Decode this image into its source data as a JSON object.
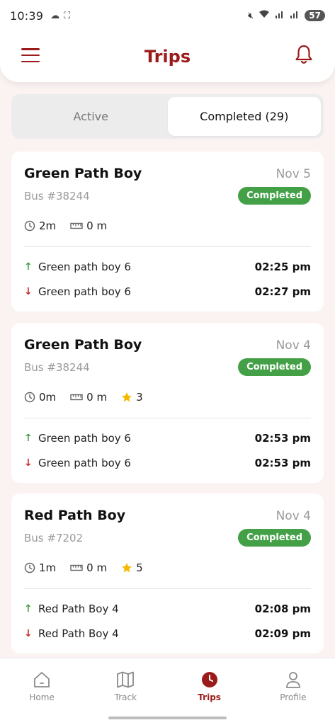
{
  "status_bar": {
    "time": "10:39",
    "battery": "57"
  },
  "header": {
    "title": "Trips",
    "accent_color": "#9b1b1b"
  },
  "tabs": [
    {
      "label": "Active",
      "active": false
    },
    {
      "label": "Completed (29)",
      "active": true
    }
  ],
  "trips": [
    {
      "name": "Green Path Boy",
      "date": "Nov 5",
      "bus": "Bus #38244",
      "status": "Completed",
      "duration": "2m",
      "distance": "0 m",
      "rating": null,
      "pickup": {
        "stop": "Green path boy 6",
        "time": "02:25 pm"
      },
      "drop": {
        "stop": "Green path boy 6",
        "time": "02:27 pm"
      }
    },
    {
      "name": "Green Path Boy",
      "date": "Nov 4",
      "bus": "Bus #38244",
      "status": "Completed",
      "duration": "0m",
      "distance": "0 m",
      "rating": "3",
      "pickup": {
        "stop": "Green path boy 6",
        "time": "02:53 pm"
      },
      "drop": {
        "stop": "Green path boy 6",
        "time": "02:53 pm"
      }
    },
    {
      "name": "Red Path Boy",
      "date": "Nov 4",
      "bus": "Bus #7202",
      "status": "Completed",
      "duration": "1m",
      "distance": "0 m",
      "rating": "5",
      "pickup": {
        "stop": "Red Path Boy 4",
        "time": "02:08 pm"
      },
      "drop": {
        "stop": "Red Path Boy 4",
        "time": "02:09 pm"
      }
    }
  ],
  "nav": [
    {
      "label": "Home",
      "icon": "home-icon",
      "active": false
    },
    {
      "label": "Track",
      "icon": "map-icon",
      "active": false
    },
    {
      "label": "Trips",
      "icon": "clock-icon",
      "active": true
    },
    {
      "label": "Profile",
      "icon": "user-icon",
      "active": false
    }
  ],
  "colors": {
    "completed_badge": "#43a047",
    "pickup_arrow": "#43a047",
    "drop_arrow": "#c62828",
    "rating_star": "#f5b800"
  }
}
